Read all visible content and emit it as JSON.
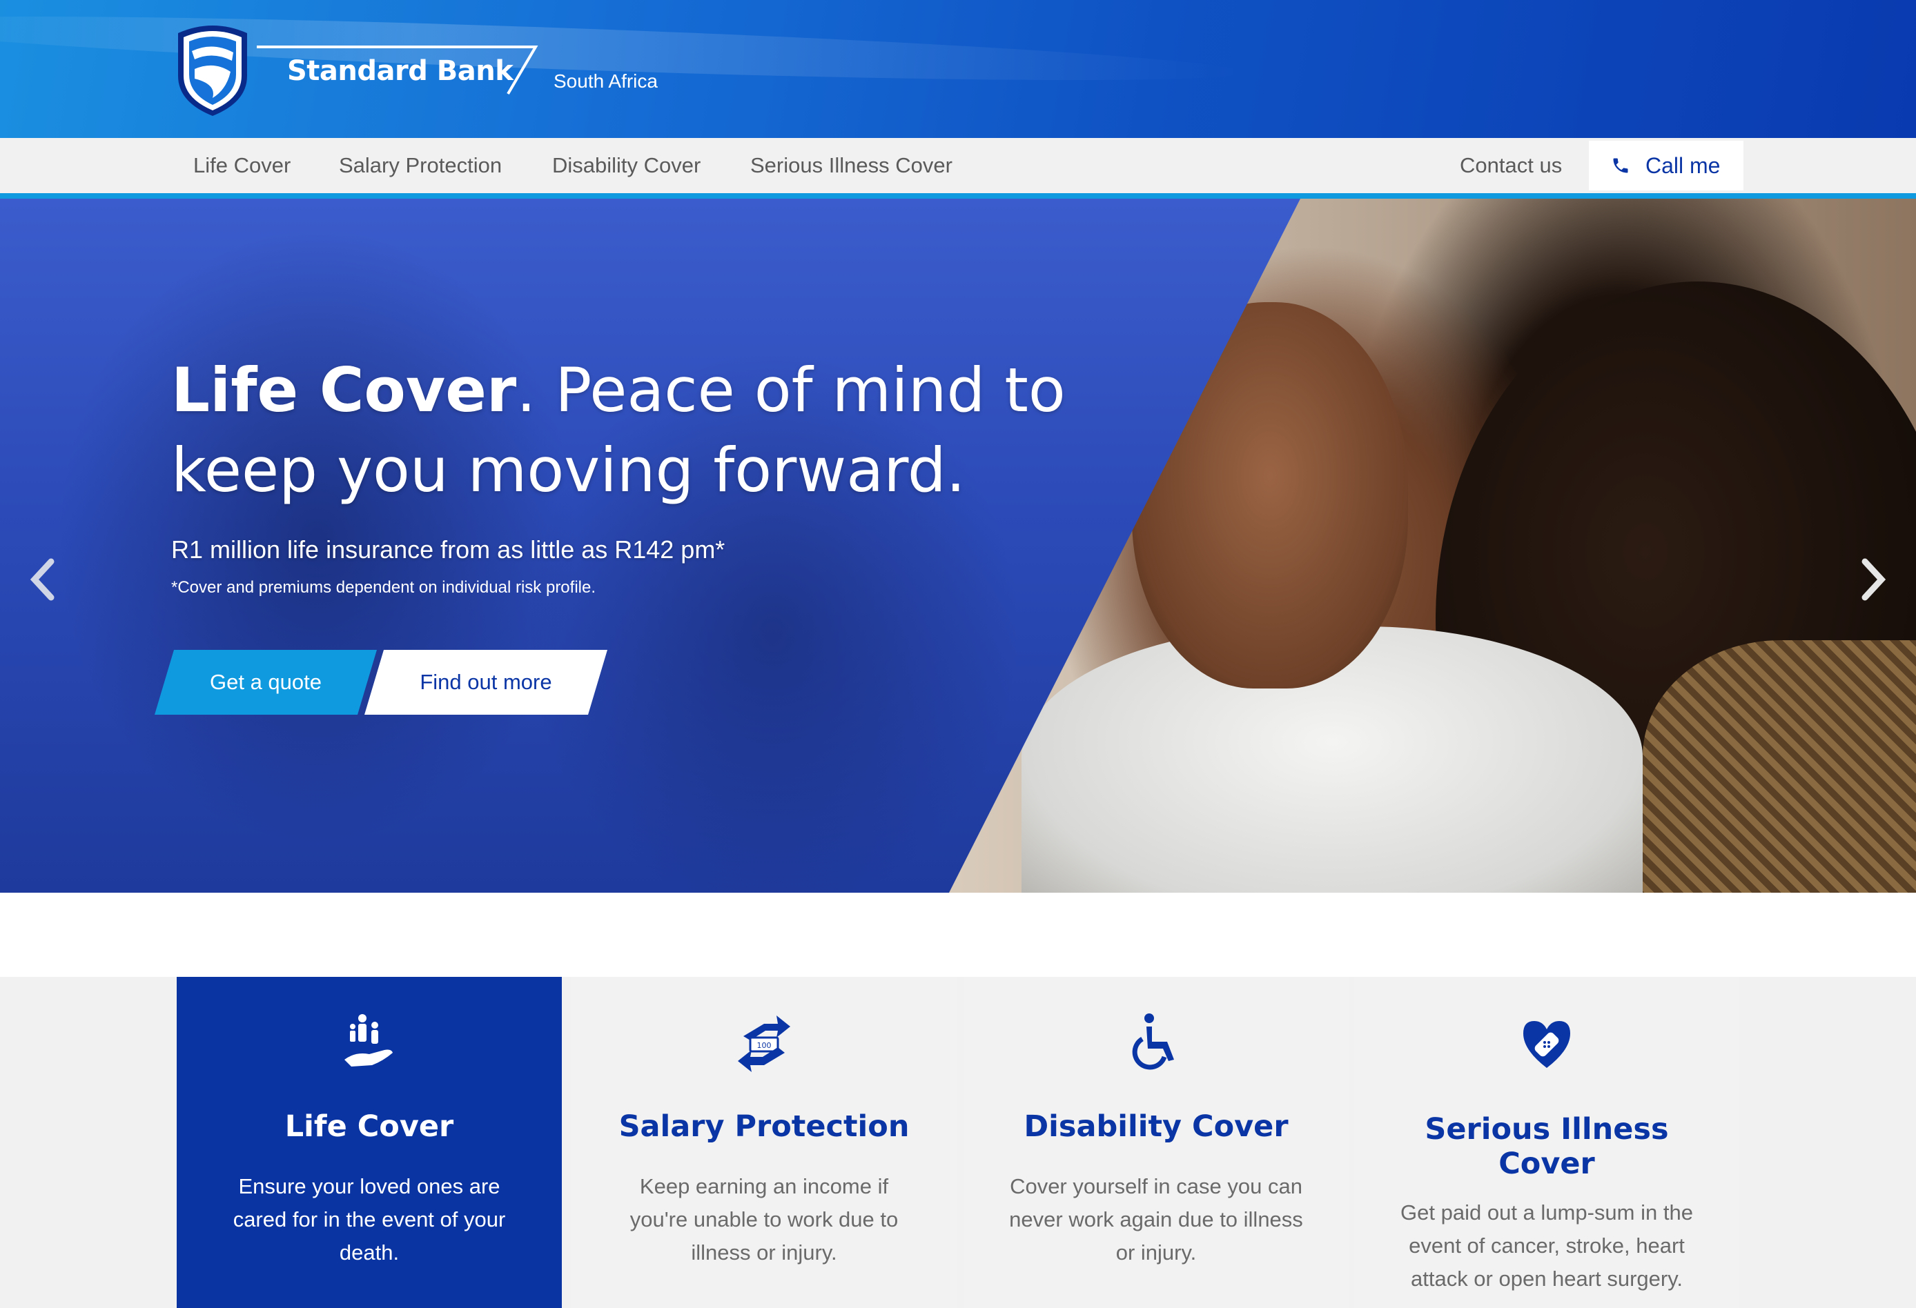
{
  "header": {
    "brand": "Standard Bank",
    "region": "South Africa"
  },
  "nav": {
    "items": [
      "Life Cover",
      "Salary Protection",
      "Disability Cover",
      "Serious Illness Cover"
    ],
    "contact": "Contact us",
    "call_me": "Call me"
  },
  "hero": {
    "title_bold": "Life Cover",
    "title_rest": ". Peace of mind to keep you moving forward.",
    "subtitle": "R1 million life insurance from as little as R142 pm*",
    "note": "*Cover and premiums dependent on individual risk profile.",
    "cta_quote": "Get a quote",
    "cta_more": "Find out more"
  },
  "cards": [
    {
      "title": "Life Cover",
      "description": "Ensure your loved ones are cared for in the event of your death.",
      "icon": "family-hand-icon",
      "active": true
    },
    {
      "title": "Salary Protection",
      "description": "Keep earning an income if you're unable to work due to illness or injury.",
      "icon": "money-hands-icon",
      "active": false
    },
    {
      "title": "Disability Cover",
      "description": "Cover yourself in case you can never work again due to illness or injury.",
      "icon": "wheelchair-icon",
      "active": false
    },
    {
      "title": "Serious Illness Cover",
      "description": "Get paid out a lump-sum in the event of cancer, stroke, heart attack or open heart surgery.",
      "icon": "heart-bandage-icon",
      "active": false
    }
  ],
  "icon_badge": "100",
  "colors": {
    "brand_blue": "#0a34a2",
    "accent_cyan": "#0f9ae0",
    "nav_bg": "#f1f1f1"
  }
}
